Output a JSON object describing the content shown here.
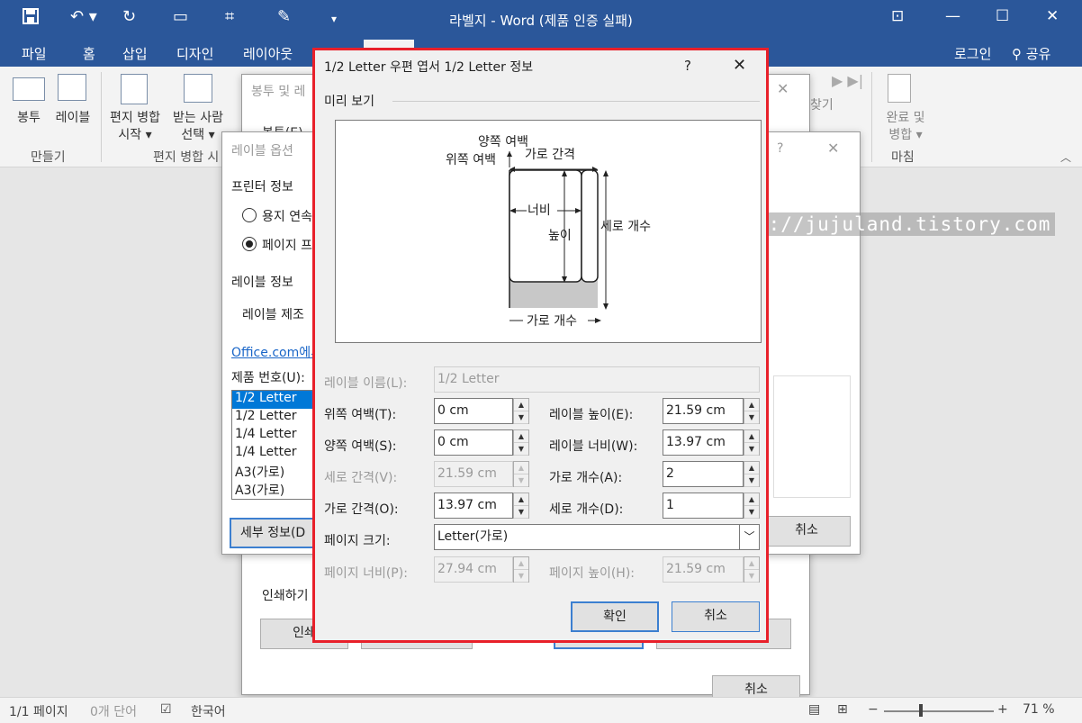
{
  "window": {
    "title": "라벨지 - Word (제품 인증 실패)"
  },
  "tabs": {
    "file": "파일",
    "home": "홈",
    "insert": "삽입",
    "design": "디자인",
    "layout": "레이아웃",
    "login": "로그인",
    "share": "공유"
  },
  "ribbon": {
    "envelope": "봉투",
    "label": "레이블",
    "mm_start_1": "편지 병합",
    "mm_start_2": "시작 ▾",
    "recipients_1": "받는 사람",
    "recipients_2": "선택 ▾",
    "group_create": "만들기",
    "group_mm": "편지 병합 시",
    "find": "찾기",
    "finish_1": "완료 및",
    "finish_2": "병합 ▾",
    "group_finish": "마침"
  },
  "bg_dialog1": {
    "title": "봉투 및 레",
    "tab": "봉투(E)",
    "print_label": "인쇄하기",
    "btn_print": "인쇄",
    "btn_cancel": "취소"
  },
  "bg_dialog2": {
    "title": "레이블 옵션",
    "printer_info": "프린터 정보",
    "radio_continuous": "용지 연속",
    "radio_page": "페이지 프",
    "label_info": "레이블 정보",
    "label_vendor": "레이블 제조",
    "office_link": "Office.com에서",
    "product_no": "제품 번호(U):",
    "products": [
      "1/2 Letter",
      "1/2 Letter",
      "1/4 Letter",
      "1/4 Letter",
      "A3(가로)",
      "A3(가로)"
    ],
    "btn_details": "세부 정보(D",
    "btn_cancel": "취소"
  },
  "dialog": {
    "title": "1/2 Letter 우편 엽서 1/2 Letter 정보",
    "help": "?",
    "close": "✕",
    "preview_label": "미리 보기",
    "diagram": {
      "side_margin": "양쪽 여백",
      "top_margin": "위쪽 여백",
      "h_pitch": "가로 간격",
      "width": "너비",
      "height": "높이",
      "vertical_count": "세로 개수",
      "horizontal_count": "가로 개수"
    },
    "fields": {
      "label_name": {
        "label": "레이블 이름(L):",
        "value": "1/2 Letter"
      },
      "top_margin": {
        "label": "위쪽 여백(T):",
        "value": "0 cm"
      },
      "side_margin": {
        "label": "양쪽 여백(S):",
        "value": "0 cm"
      },
      "v_pitch": {
        "label": "세로 간격(V):",
        "value": "21.59 cm"
      },
      "h_pitch": {
        "label": "가로 간격(O):",
        "value": "13.97 cm"
      },
      "label_height": {
        "label": "레이블 높이(E):",
        "value": "21.59 cm"
      },
      "label_width": {
        "label": "레이블 너비(W):",
        "value": "13.97 cm"
      },
      "across": {
        "label": "가로 개수(A):",
        "value": "2"
      },
      "down": {
        "label": "세로 개수(D):",
        "value": "1"
      },
      "page_size": {
        "label": "페이지 크기:",
        "value": "Letter(가로)"
      },
      "page_width": {
        "label": "페이지 너비(P):",
        "value": "27.94 cm"
      },
      "page_height": {
        "label": "페이지 높이(H):",
        "value": "21.59 cm"
      }
    },
    "ok": "확인",
    "cancel": "취소"
  },
  "watermark": "http://jujuland.tistory.com",
  "statusbar": {
    "page": "1/1 페이지",
    "words": "0개 단어",
    "lang": "한국어",
    "zoom": "71 %"
  },
  "colors": {
    "accent": "#2b579a",
    "highlight": "#e8202a",
    "selected": "#0078d7"
  }
}
